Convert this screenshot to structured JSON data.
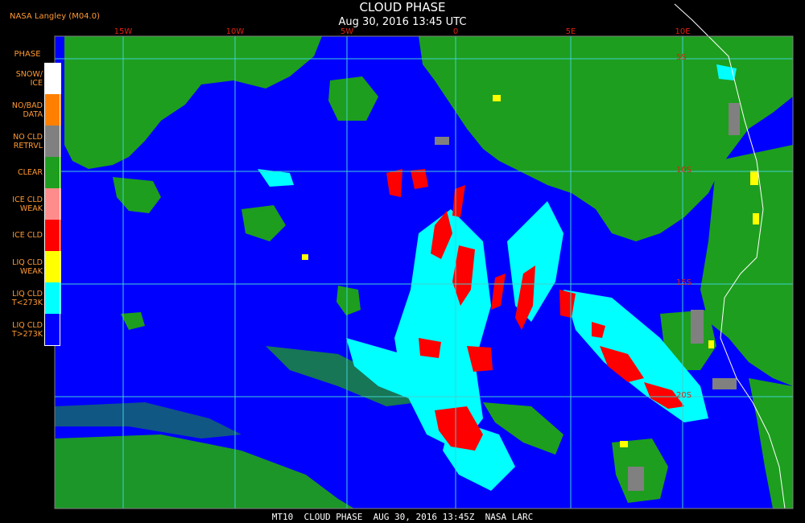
{
  "header": {
    "title": "CLOUD PHASE",
    "date": "Aug 30, 2016 13:45 UTC",
    "source": "NASA Langley (M04.0)"
  },
  "legend": {
    "heading": "PHASE",
    "items": [
      {
        "label": "SNOW/\nICE",
        "color": "#ffffff"
      },
      {
        "label": "NO/BAD\nDATA",
        "color": "#ff8000"
      },
      {
        "label": "NO CLD\nRETRVL",
        "color": "#808080"
      },
      {
        "label": "CLEAR",
        "color": "#1e9e1e"
      },
      {
        "label": "ICE CLD\nWEAK",
        "color": "#ff8c8c"
      },
      {
        "label": "ICE CLD",
        "color": "#ff0000"
      },
      {
        "label": "LIQ CLD\nWEAK",
        "color": "#ffff00"
      },
      {
        "label": "LIQ CLD\nT<273K",
        "color": "#00ffff"
      },
      {
        "label": "LIQ CLD\nT>273K",
        "color": "#0000ff"
      }
    ]
  },
  "grid": {
    "longitudes": [
      "15W",
      "10W",
      "5W",
      "0",
      "5E",
      "10E"
    ],
    "latitudes": [
      "5S",
      "10S",
      "15S",
      "20S"
    ],
    "line_color": "#40d0d0",
    "label_color": "#e02010"
  },
  "map": {
    "ocean_color": "#0000ff",
    "land_color": "#1e9e1e"
  },
  "footer": {
    "text": "MT10  CLOUD PHASE  AUG 30, 2016 13:45Z  NASA LARC"
  }
}
